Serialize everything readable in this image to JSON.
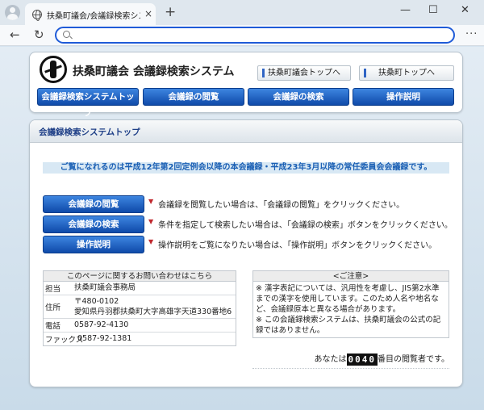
{
  "browser": {
    "tab_title": "扶桑町議会/会議録検索システム",
    "tab_close": "×",
    "new_tab": "+",
    "minimize": "—",
    "maximize": "☐",
    "close": "✕",
    "back": "←",
    "reload": "↻",
    "more": "···",
    "url_value": ""
  },
  "header": {
    "title": "扶桑町議会  会議録検索システム",
    "link_council": "扶桑町議会トップへ",
    "link_town": "扶桑町トップへ",
    "nav": [
      "会議録検索システムトップ",
      "会議録の閲覧",
      "会議録の検索",
      "操作説明"
    ]
  },
  "main": {
    "section_title": "会議録検索システムトップ",
    "notice": "ご覧になれるのは平成12年第2回定例会以降の本会議録・平成23年3月以降の常任委員会会議録です。",
    "actions": [
      {
        "label": "会議録の閲覧",
        "desc": "会議録を閲覧したい場合は、「会議録の閲覧」をクリックください。"
      },
      {
        "label": "会議録の検索",
        "desc": "条件を指定して検索したい場合は、「会議録の検索」ボタンをクリックください。"
      },
      {
        "label": "操作説明",
        "desc": "操作説明をご覧になりたい場合は、「操作説明」ボタンをクリックください。"
      }
    ],
    "marker": "▼"
  },
  "contact": {
    "heading": "このページに関するお問い合わせはこちら",
    "rows": [
      {
        "label": "担当",
        "value": "扶桑町議会事務局"
      },
      {
        "label": "住所",
        "value": "〒480-0102",
        "value2": "愛知県丹羽郡扶桑町大字高雄字天道330番地6"
      },
      {
        "label": "電話",
        "value": "0587-92-4130"
      },
      {
        "label": "ファックス",
        "value": "0587-92-1381"
      }
    ]
  },
  "caution": {
    "heading": "<ご注意>",
    "p1": "※ 漢字表記については、汎用性を考慮し、JIS第2水準までの漢字を使用しています。このため人名や地名など、会議録原本と異なる場合があります。",
    "p2": "※ この会議録検索システムは、扶桑町議会の公式の記録ではありません。"
  },
  "counter": {
    "prefix": "あなたは",
    "digits": "0040",
    "suffix": "番目の閲覧者です。"
  }
}
